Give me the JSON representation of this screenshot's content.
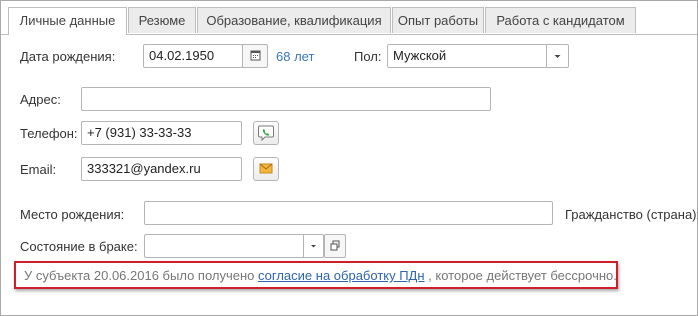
{
  "tabs": [
    {
      "label": "Личные данные",
      "active": true
    },
    {
      "label": "Резюме",
      "active": false
    },
    {
      "label": "Образование, квалификация",
      "active": false
    },
    {
      "label": "Опыт работы",
      "active": false
    },
    {
      "label": "Работа с кандидатом",
      "active": false
    }
  ],
  "personal": {
    "birth_date_label": "Дата рождения:",
    "birth_date_value": "04.02.1950",
    "age": "68 лет",
    "gender_label": "Пол:",
    "gender_value": "Мужской",
    "address_label": "Адрес:",
    "address_value": "",
    "phone_label": "Телефон:",
    "phone_value": "+7 (931) 33-33-33",
    "email_label": "Email:",
    "email_value": "333321@yandex.ru",
    "birthplace_label": "Место рождения:",
    "birthplace_value": "",
    "citizenship_label": "Гражданство (страна):",
    "marital_label": "Состояние в браке:",
    "marital_value": ""
  },
  "notice": {
    "prefix": "У субъекта 20.06.2016 было получено",
    "link": "согласие на обработку ПДн",
    "suffix": ", которое действует бессрочно."
  },
  "icons": {
    "calendar": "calendar-icon",
    "dropdown": "chevron-down-icon",
    "phone": "phone-call-icon",
    "email": "envelope-icon",
    "open": "open-form-icon"
  },
  "colors": {
    "link": "#2e64b0",
    "age": "#3b78b5",
    "notice_border": "#d01e2a"
  }
}
